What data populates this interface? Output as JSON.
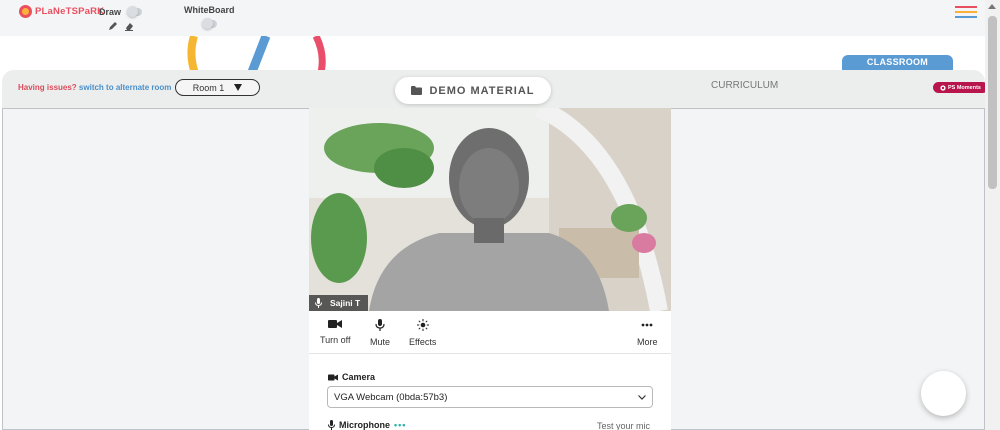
{
  "app": {
    "logo_text": "PLaNeTSPaRK"
  },
  "toolbar": {
    "draw_label": "Draw",
    "whiteboard_label": "WhiteBoard"
  },
  "menu_colors": [
    "#e94f5f",
    "#fbb03b",
    "#5a9bd4"
  ],
  "tabs": {
    "classroom": "CLASSROOM",
    "curriculum": "CURRICULUM"
  },
  "strip": {
    "issues_text": "Having issues?",
    "alternate_room_link": "switch to alternate room",
    "room_selected": "Room 1",
    "demo_material": "DEMO MATERIAL",
    "ps_moments": "PS Moments"
  },
  "video": {
    "participant_name": "Sajini T"
  },
  "controls": {
    "turn_off": "Turn off",
    "mute": "Mute",
    "effects": "Effects",
    "more": "More"
  },
  "settings": {
    "camera_label": "Camera",
    "camera_value": "VGA Webcam (0bda:57b3)",
    "microphone_label": "Microphone",
    "mic_indicator": "•••",
    "test_mic": "Test your mic"
  },
  "colors": {
    "accent_blue": "#5a9bd4",
    "brand_red": "#e94f5f",
    "ps_moments": "#b7154b"
  }
}
